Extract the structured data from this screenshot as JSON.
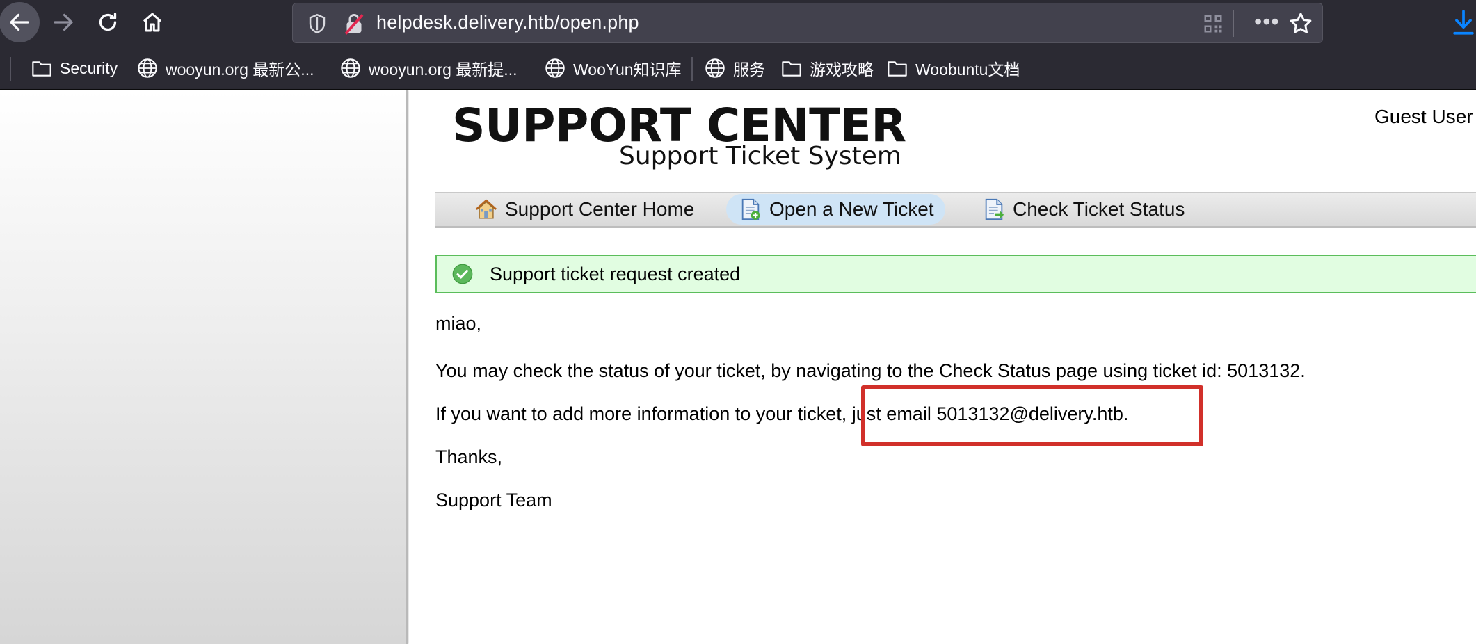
{
  "browser": {
    "url": "helpdesk.delivery.htb/open.php",
    "bookmarks": [
      {
        "label": "Security",
        "icon": "folder-icon"
      },
      {
        "label": "wooyun.org 最新公...",
        "icon": "globe-icon"
      },
      {
        "label": "wooyun.org 最新提...",
        "icon": "globe-icon"
      },
      {
        "label": "WooYun知识库",
        "icon": "globe-icon"
      },
      {
        "label": "服务",
        "icon": "globe-icon"
      },
      {
        "label": "游戏攻略",
        "icon": "folder-icon"
      },
      {
        "label": "Woobuntu文档",
        "icon": "folder-icon"
      }
    ]
  },
  "page": {
    "logo_title": "SUPPORT CENTER",
    "logo_subtitle": "Support Ticket System",
    "user": "Guest User",
    "nav": [
      {
        "label": "Support Center Home",
        "icon": "home-icon"
      },
      {
        "label": "Open a New Ticket",
        "icon": "new-ticket-icon",
        "active": true
      },
      {
        "label": "Check Ticket Status",
        "icon": "ticket-status-icon"
      }
    ],
    "notice": "Support ticket request created",
    "message": {
      "greeting": "miao,",
      "status_line": "You may check the status of your ticket, by navigating to the Check Status page using ticket id: 5013132.",
      "email_line": "If you want to add more information to your ticket, just email 5013132@delivery.htb.",
      "thanks": "Thanks,",
      "signature": "Support Team"
    }
  },
  "colors": {
    "highlight": "#d1302a",
    "notice_bg": "#e1fde1",
    "notice_border": "#5bbd5b",
    "active_nav": "#cfe4f6"
  }
}
